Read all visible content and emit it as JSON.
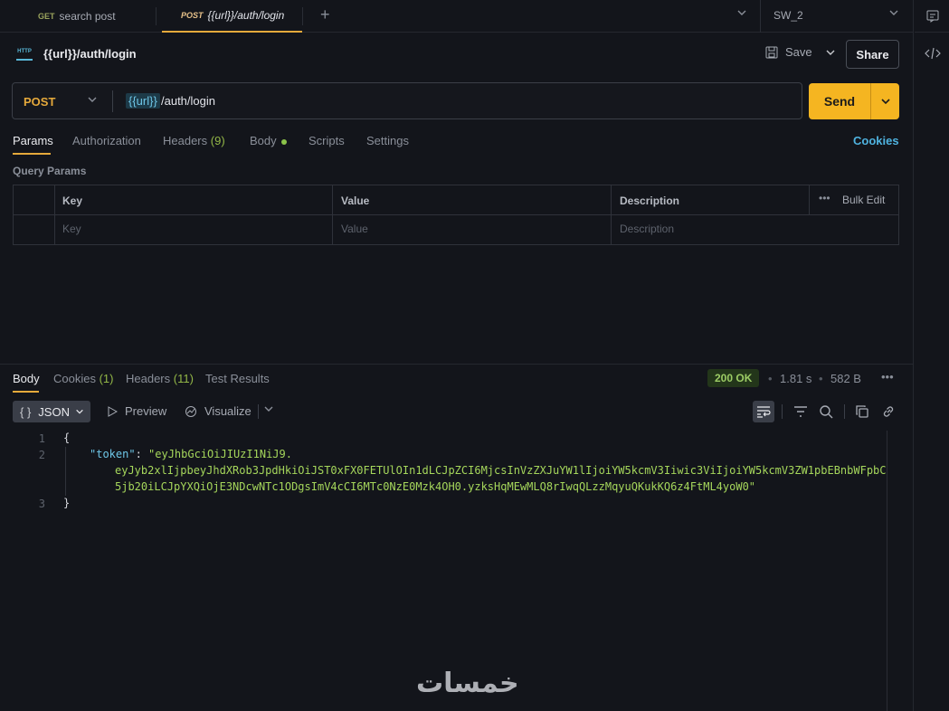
{
  "tabs": [
    {
      "method": "GET",
      "name": "search post"
    },
    {
      "method": "POST",
      "name": "{{url}}/auth/login"
    }
  ],
  "workspace": "SW_2",
  "request": {
    "title": "{{url}}/auth/login",
    "method": "POST",
    "url_variable": "{{url}}",
    "url_path": " /auth/login",
    "save_label": "Save",
    "share_label": "Share",
    "send_label": "Send"
  },
  "request_tabs": {
    "params": "Params",
    "authorization": "Authorization",
    "headers": "Headers",
    "headers_count": "(9)",
    "body": "Body",
    "scripts": "Scripts",
    "settings": "Settings",
    "cookies": "Cookies"
  },
  "query_params": {
    "title": "Query Params",
    "columns": [
      "Key",
      "Value",
      "Description"
    ],
    "bulk_edit": "Bulk Edit",
    "placeholders": [
      "Key",
      "Value",
      "Description"
    ]
  },
  "response": {
    "tabs": {
      "body": "Body",
      "cookies": "Cookies",
      "cookies_count": "(1)",
      "headers": "Headers",
      "headers_count": "(11)",
      "test_results": "Test Results"
    },
    "status": "200 OK",
    "time": "1.81 s",
    "size": "582 B",
    "format": "JSON",
    "preview": "Preview",
    "visualize": "Visualize",
    "lines": {
      "l1": "1",
      "l2": "2",
      "l3": "3",
      "open_brace": "{",
      "close_brace": "}",
      "token_key": "\"token\"",
      "token_value_1": "\"eyJhbGciOiJIUzI1NiJ9.",
      "token_value_2": "eyJyb2xlIjpbeyJhdXRob3JpdHkiOiJST0xFX0FETUlOIn1dLCJpZCI6MjcsInVzZXJuYW1lIjoiYW5kcmV3Iiwic3ViIjoiYW5kcmV3ZW1pbEBnbWFpbC",
      "token_value_3": "5jb20iLCJpYXQiOjE3NDcwNTc1ODgsImV4cCI6MTc0NzE0Mzk4OH0.yzksHqMEwMLQ8rIwqQLzzMqyuQKukKQ6z4FtML4yoW0\""
    }
  },
  "watermark": "خمسات"
}
